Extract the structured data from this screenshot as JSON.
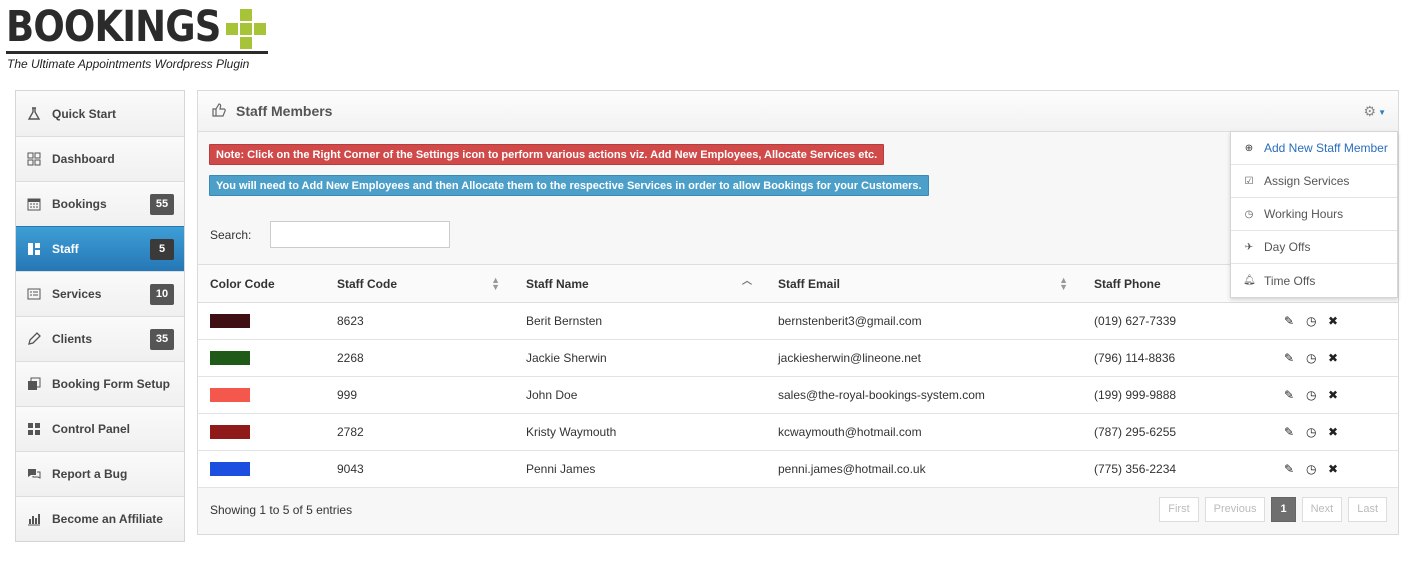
{
  "brand": {
    "name": "BOOKINGS",
    "tagline": "The Ultimate Appointments Wordpress Plugin",
    "accent_color": "#a7c439"
  },
  "sidebar": {
    "items": [
      {
        "label": "Quick Start",
        "icon": "flask-icon"
      },
      {
        "label": "Dashboard",
        "icon": "grid-icon"
      },
      {
        "label": "Bookings",
        "icon": "calendar-icon",
        "badge": "55"
      },
      {
        "label": "Staff",
        "icon": "layout-icon",
        "badge": "5",
        "active": true
      },
      {
        "label": "Services",
        "icon": "list-icon",
        "badge": "10"
      },
      {
        "label": "Clients",
        "icon": "pencil-icon",
        "badge": "35"
      },
      {
        "label": "Booking Form Setup",
        "icon": "copy-icon"
      },
      {
        "label": "Control Panel",
        "icon": "tiles-icon"
      },
      {
        "label": "Report a Bug",
        "icon": "comments-icon"
      },
      {
        "label": "Become an Affiliate",
        "icon": "bar-chart-icon"
      }
    ]
  },
  "panel": {
    "title": "Staff Members",
    "notice_red": "Note: Click on the Right Corner of the Settings icon to perform various actions viz. Add New Employees, Allocate Services etc.",
    "notice_blue": "You will need to Add New Employees and then Allocate them to the respective Services in order to allow Bookings for your Customers.",
    "search_label": "Search:",
    "search_value": ""
  },
  "table": {
    "headers": [
      "Color Code",
      "Staff Code",
      "Staff Name",
      "Staff Email",
      "Staff Phone"
    ],
    "rows": [
      {
        "color": "#3f0f14",
        "code": "8623",
        "name": "Berit Bernsten",
        "email": "bernstenberit3@gmail.com",
        "phone": "(019) 627-7339"
      },
      {
        "color": "#1f5a18",
        "code": "2268",
        "name": "Jackie Sherwin",
        "email": "jackiesherwin@lineone.net",
        "phone": "(796) 114-8836"
      },
      {
        "color": "#f4584d",
        "code": "999",
        "name": "John Doe",
        "email": "sales@the-royal-bookings-system.com",
        "phone": "(199) 999-9888"
      },
      {
        "color": "#901a1a",
        "code": "2782",
        "name": "Kristy Waymouth",
        "email": "kcwaymouth@hotmail.com",
        "phone": "(787) 295-6255"
      },
      {
        "color": "#1c4fe0",
        "code": "9043",
        "name": "Penni James",
        "email": "penni.james@hotmail.co.uk",
        "phone": "(775) 356-2234"
      }
    ]
  },
  "footer": {
    "info": "Showing 1 to 5 of 5 entries",
    "pager": {
      "first": "First",
      "previous": "Previous",
      "current": "1",
      "next": "Next",
      "last": "Last"
    }
  },
  "dropdown": {
    "items": [
      {
        "label": "Add New Staff Member",
        "icon": "plus-circle-icon"
      },
      {
        "label": "Assign Services",
        "icon": "check-square-icon"
      },
      {
        "label": "Working Hours",
        "icon": "clock-icon"
      },
      {
        "label": "Day Offs",
        "icon": "plane-icon"
      },
      {
        "label": "Time Offs",
        "icon": "bell-icon"
      }
    ]
  }
}
